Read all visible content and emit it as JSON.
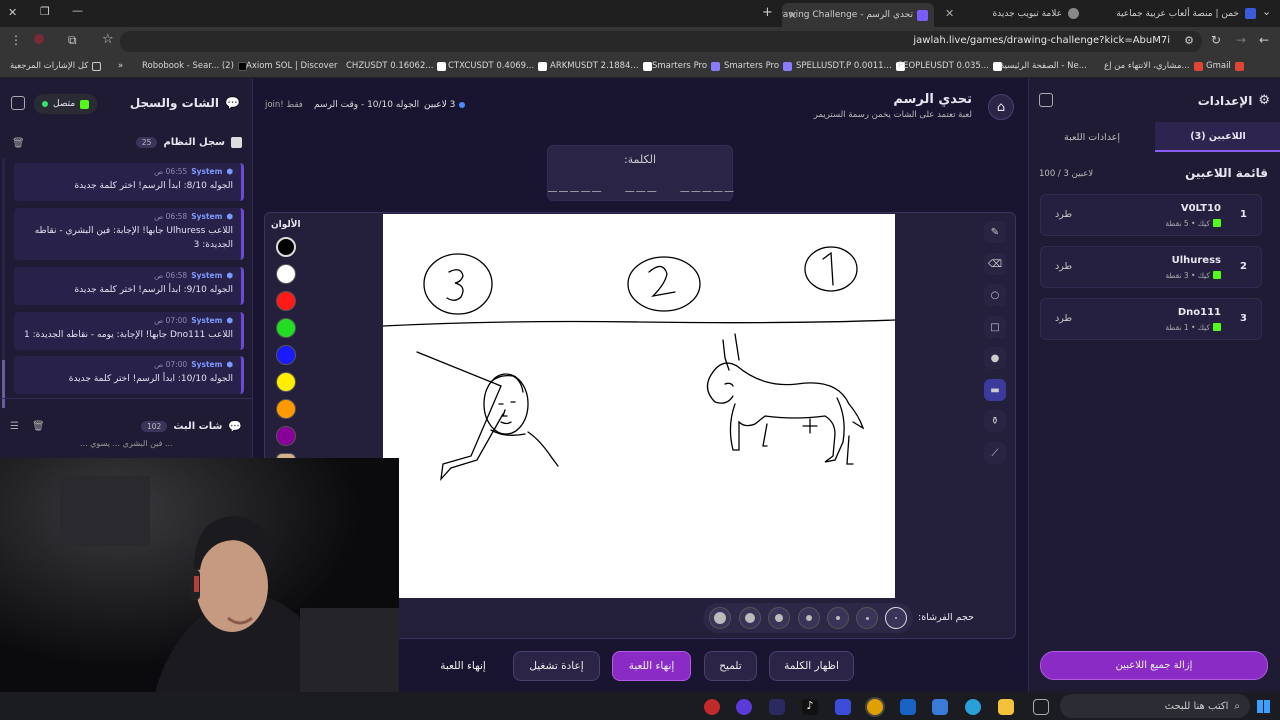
{
  "browser": {
    "tabs": [
      {
        "title": "خمن | منصة ألعاب عربية جماعية",
        "color": "#3b5bdb"
      },
      {
        "title": "علامة تبويب جديدة",
        "color": "#888888"
      },
      {
        "title": "تحدي الرسم - Drawing Challenge",
        "color": "#7b5cff"
      }
    ],
    "url": "jawlah.live/games/drawing-challenge?kick=AbuM7i",
    "bookmarks": [
      "Gmail",
      "مشاري، الانتهاء من إع...",
      "الصفحة الرئيسية - Ne...",
      "PEOPLEUSDT 0.035...",
      "SPELLUSDT.P 0.0011...",
      "Smarters Pro",
      "Smarters Pro",
      "ARKMUSDT 2.1884...",
      "CTXCUSDT 0.4069...",
      "CHZUSDT 0.16062...",
      "Axiom SOL | Discover",
      "Robobook - Sear... (2)",
      "كل الإشارات المرجعية"
    ]
  },
  "settings_panel": {
    "title": "الإعدادات",
    "tabs": [
      "اللاعبين (3)",
      "إعدادات اللعبة"
    ],
    "list_title": "قائمة اللاعبين",
    "count": "100 / 3 لاعبين",
    "players": [
      {
        "rank": "1",
        "name": "V0LT10",
        "meta": "كيك • 5 نقطة",
        "kick": "طرد"
      },
      {
        "rank": "2",
        "name": "Ulhuress",
        "meta": "كيك • 3 نقطة",
        "kick": "طرد"
      },
      {
        "rank": "3",
        "name": "Dno111",
        "meta": "كيك • 1 نقطة",
        "kick": "طرد"
      }
    ],
    "remove_all": "إزالة جميع اللاعبين"
  },
  "game": {
    "title": "تحدي الرسم",
    "subtitle": "لعبة تعتمد على الشات يخمن رسمة الستريمر",
    "players_badge": "3 لاعبين",
    "round_info": "الجوله 10/10 - وقت الرسم",
    "join_hint": "join! فقط",
    "word_label": "الكلمة:",
    "word_mask": "_____  ___  _____",
    "colors_label": "الألوان",
    "colors": [
      "#000000",
      "#ffffff",
      "#ff1a1a",
      "#22dd22",
      "#1a1aff",
      "#ffee00",
      "#ff9900",
      "#880099",
      "#d2b48c"
    ],
    "brush_label": "حجم الفرشاة:",
    "buttons": {
      "show_word": "اظهار الكلمة",
      "hint": "تلميح",
      "end_game": "إنهاء اللعبة",
      "restart": "إعادة تشغيل",
      "end_game2": "إنهاء اللعبة"
    }
  },
  "chat_panel": {
    "title": "الشات والسجل",
    "status": "متصل",
    "log_title": "سجل النظام",
    "log_count": "25",
    "messages": [
      {
        "author": "System",
        "time": "06:55 ص",
        "text": "الجوله 8/10: ابدأ الرسم! اختر كلمة جديدة"
      },
      {
        "author": "System",
        "time": "06:58 ص",
        "text": "اللاعب Ulhuress جابها! الإجابة: فين البشري - نقاطه الجديدة: 3"
      },
      {
        "author": "System",
        "time": "06:58 ص",
        "text": "الجوله 9/10: ابدأ الرسم! اختر كلمة جديدة"
      },
      {
        "author": "System",
        "time": "07:00 ص",
        "text": "اللاعب Dno111 جابها! الإجابة: يومه - نقاطه الجديدة: 1"
      },
      {
        "author": "System",
        "time": "07:00 ص",
        "text": "الجوله 10/10: ابدأ الرسم! اختر كلمة جديدة"
      }
    ],
    "stream_chat_title": "شات البث",
    "stream_chat_count": "102",
    "stream_chat_peek": "... فين البشري ... يسوي ..."
  },
  "taskbar": {
    "search_placeholder": "اكتب هنا للبحث"
  }
}
